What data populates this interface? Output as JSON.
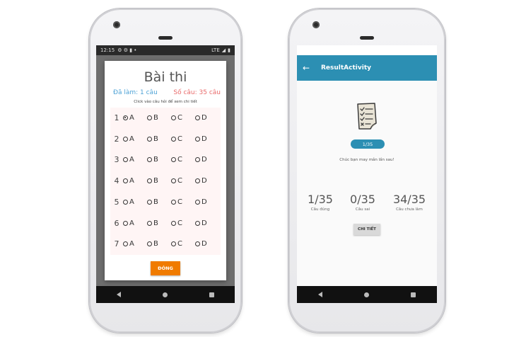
{
  "left_phone": {
    "status_bar": {
      "time": "12:15",
      "network": "LTE"
    },
    "dialog": {
      "title": "Bài thi",
      "answered": "Đã làm: 1 câu",
      "total": "Số câu: 35 câu",
      "hint": "Click vào câu hỏi để xem chi tiết",
      "questions": [
        {
          "num": "1",
          "selected": "A"
        },
        {
          "num": "2",
          "selected": ""
        },
        {
          "num": "3",
          "selected": ""
        },
        {
          "num": "4",
          "selected": ""
        },
        {
          "num": "5",
          "selected": ""
        },
        {
          "num": "6",
          "selected": ""
        },
        {
          "num": "7",
          "selected": ""
        }
      ],
      "options": [
        "A",
        "B",
        "C",
        "D"
      ],
      "close_label": "ĐÓNG"
    }
  },
  "right_phone": {
    "toolbar_title": "ResultActivity",
    "score": "1/35",
    "message": "Chúc bạn may mắn lần sau!",
    "stats": [
      {
        "value": "1/35",
        "label": "Câu đúng"
      },
      {
        "value": "0/35",
        "label": "Câu sai"
      },
      {
        "value": "34/35",
        "label": "Câu chưa làm"
      }
    ],
    "detail_label": "CHI TIẾT"
  },
  "colors": {
    "accent": "#2c8fb3",
    "close_button": "#f07b00",
    "answered": "#4fa3d6",
    "total": "#e96b6b"
  }
}
